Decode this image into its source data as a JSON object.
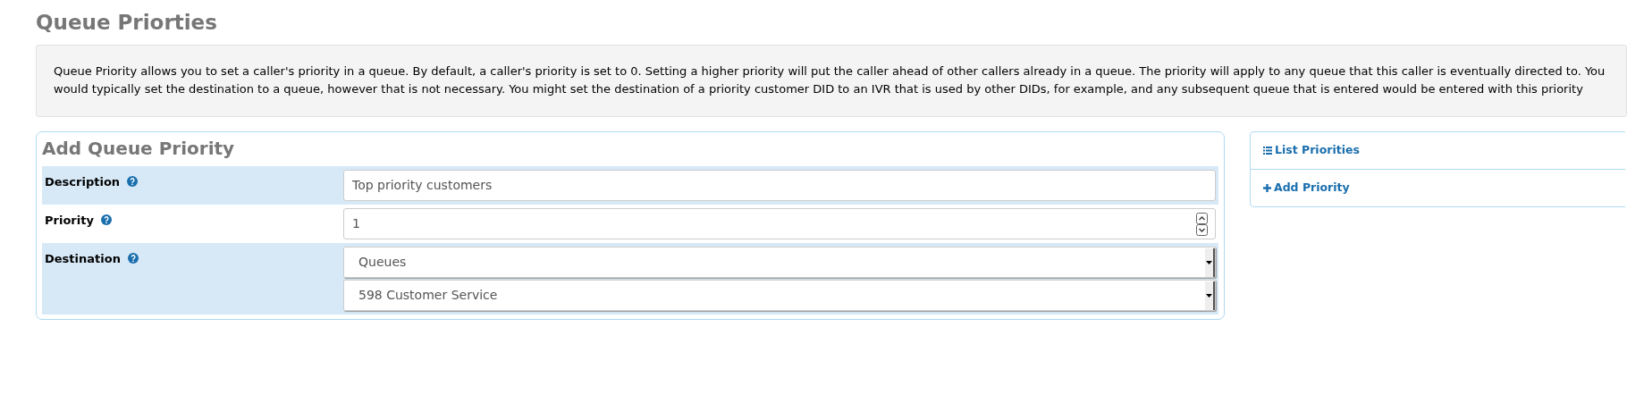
{
  "page_title": "Queue Priorties",
  "info": "Queue Priority allows you to set a caller's priority in a queue. By default, a caller's priority is set to 0. Setting a higher priority will put the caller ahead of other callers already in a queue. The priority will apply to any queue that this caller is eventually directed to. You would typically set the destination to a queue, however that is not necessary. You might set the destination of a priority customer DID to an IVR that is used by other DIDs, for example, and any subsequent queue that is entered would be entered with this priority",
  "form": {
    "title": "Add Queue Priority",
    "rows": [
      {
        "label": "Description",
        "controls": [
          {
            "kind": "text",
            "value": "Top priority customers"
          }
        ]
      },
      {
        "label": "Priority",
        "controls": [
          {
            "kind": "number",
            "value": "1"
          }
        ]
      },
      {
        "label": "Destination",
        "controls": [
          {
            "kind": "select",
            "value": "Queues"
          },
          {
            "kind": "select",
            "value": "598 Customer Service"
          }
        ]
      }
    ]
  },
  "sidebar": {
    "items": [
      {
        "label": "List Priorities",
        "kind": "list"
      },
      {
        "label": "Add Priority",
        "kind": "add"
      }
    ]
  }
}
